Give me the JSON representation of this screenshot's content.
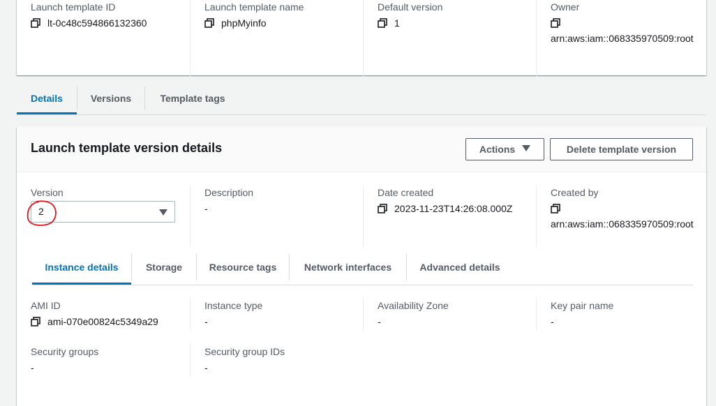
{
  "summary": {
    "fields": [
      {
        "label": "Launch template ID",
        "value": "lt-0c48c594866132360"
      },
      {
        "label": "Launch template name",
        "value": "phpMyinfo"
      },
      {
        "label": "Default version",
        "value": "1"
      },
      {
        "label": "Owner",
        "value": "arn:aws:iam::068335970509:root"
      }
    ]
  },
  "main_tabs": [
    "Details",
    "Versions",
    "Template tags"
  ],
  "version_panel": {
    "title": "Launch template version details",
    "actions_label": "Actions",
    "delete_label": "Delete template version",
    "version_label": "Version",
    "version_value": "2",
    "description_label": "Description",
    "description_value": "-",
    "date_label": "Date created",
    "date_value": "2023-11-23T14:26:08.000Z",
    "created_by_label": "Created by",
    "created_by_value": "arn:aws:iam::068335970509:root"
  },
  "sub_tabs": [
    "Instance details",
    "Storage",
    "Resource tags",
    "Network interfaces",
    "Advanced details"
  ],
  "instance": {
    "ami_label": "AMI ID",
    "ami_value": "ami-070e00824c5349a29",
    "type_label": "Instance type",
    "type_value": "-",
    "az_label": "Availability Zone",
    "az_value": "-",
    "keypair_label": "Key pair name",
    "keypair_value": "-",
    "sg_label": "Security groups",
    "sg_value": "-",
    "sgid_label": "Security group IDs",
    "sgid_value": "-"
  },
  "colors": {
    "accent": "#0073bb",
    "annotation": "#e0141e"
  },
  "icons": {
    "copy": "copy-icon",
    "caret": "caret-down-icon"
  }
}
